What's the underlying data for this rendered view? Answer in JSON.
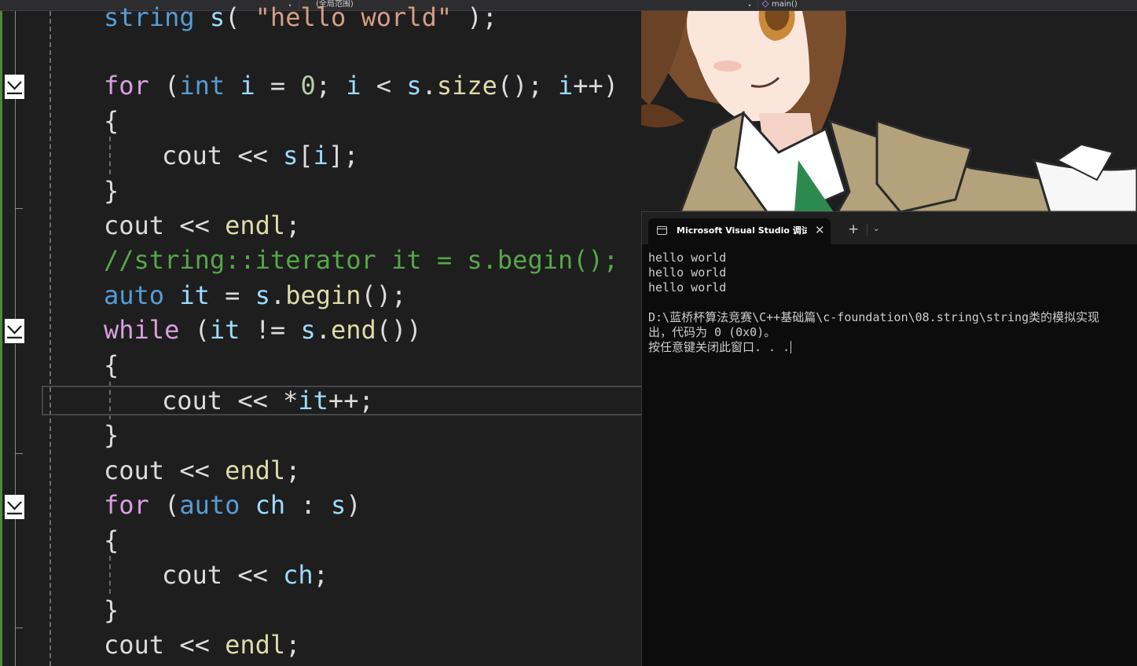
{
  "nav": {
    "scope": "(全局范围)",
    "member_icon": "cube-icon",
    "member": "main()"
  },
  "code_lines": {
    "string_decl": {
      "type": "string",
      "var": "s",
      "string_lit": "\"hello world\""
    },
    "for1": {
      "kw": "for",
      "type": "int",
      "var": "i",
      "num": "0",
      "obj": "s",
      "fn": "size"
    },
    "body1": {
      "obj": "cout",
      "target": "s",
      "idx": "i"
    },
    "endl": "endl",
    "comment": "//string::iterator it = s.begin();",
    "auto_line": {
      "type": "auto",
      "var": "it",
      "obj": "s",
      "fn": "begin"
    },
    "while_line": {
      "kw": "while",
      "var": "it",
      "obj": "s",
      "fn": "end"
    },
    "body2": {
      "obj": "cout",
      "var": "it"
    },
    "for2": {
      "kw": "for",
      "type": "auto",
      "var": "ch",
      "obj": "s"
    },
    "body3": {
      "obj": "cout",
      "var": "ch"
    }
  },
  "console": {
    "tab_icon": "terminal-icon",
    "tab_title": "Microsoft Visual Studio 调试控制台",
    "close_glyph": "✕",
    "new_tab_glyph": "+",
    "dropdown_glyph": "⌄",
    "lines": [
      "hello world",
      "hello world",
      "hello world",
      "",
      "D:\\蓝桥杯算法竞赛\\C++基础篇\\c-foundation\\08.string\\string类的模拟实现",
      "出，代码为 0 (0x0)。",
      "按任意键关闭此窗口. . ."
    ]
  },
  "colors": {
    "keyword": "#d8a0df",
    "type": "#569cd6",
    "variable": "#9cdcfe",
    "function": "#dcdcaa",
    "number": "#b5cea8",
    "comment": "#57a64a",
    "string": "#d69d85",
    "editor_bg": "#1e1e1e",
    "console_bg": "#0c0c0c"
  }
}
